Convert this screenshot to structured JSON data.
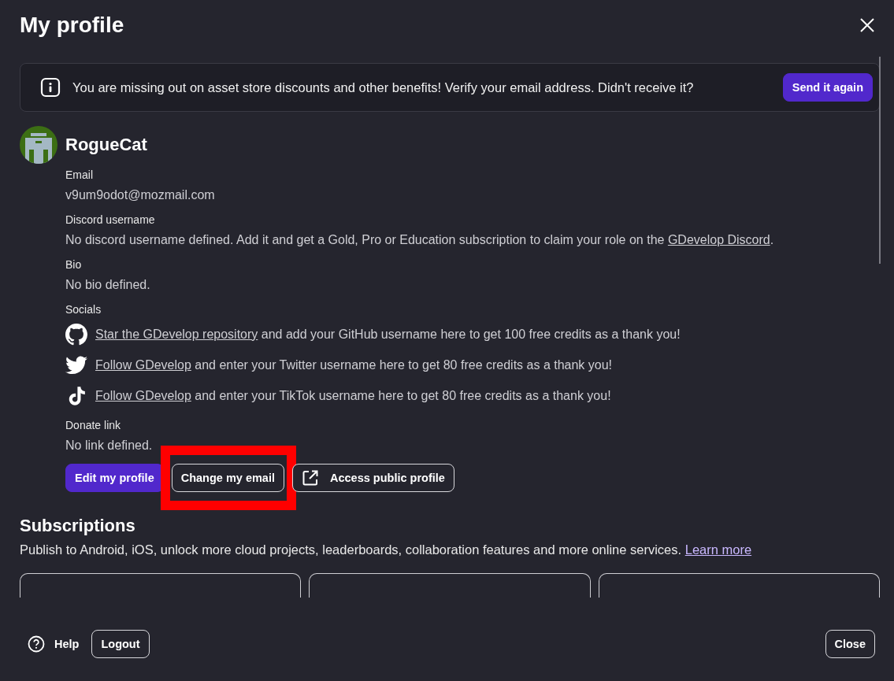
{
  "title": "My profile",
  "banner": {
    "message": "You are missing out on asset store discounts and other benefits! Verify your email address. Didn't receive it?",
    "button": "Send it again"
  },
  "user": {
    "name": "RogueCat"
  },
  "fields": [
    {
      "label": "Email",
      "value": "v9um9odot@mozmail.com"
    },
    {
      "label": "Discord username",
      "value": "No discord username defined. Add it and get a Gold, Pro or Education subscription to claim your role on the ",
      "link": "GDevelop Discord",
      "after": "."
    },
    {
      "label": "Bio",
      "value": "No bio defined."
    }
  ],
  "socials_label": "Socials",
  "socials": [
    {
      "kind": "github",
      "link": "Star the GDevelop repository",
      "text": " and add your GitHub username here to get 100 free credits as a thank you!"
    },
    {
      "kind": "twitter",
      "link": "Follow GDevelop",
      "text": " and enter your Twitter username here to get 80 free credits as a thank you!"
    },
    {
      "kind": "tiktok",
      "link": "Follow GDevelop",
      "text": " and enter your TikTok username here to get 80 free credits as a thank you!"
    }
  ],
  "donate": {
    "label": "Donate link",
    "value": "No link defined."
  },
  "actions": [
    {
      "label": "Edit my profile",
      "kind": "primary",
      "highlighted": false
    },
    {
      "label": "Change my email",
      "kind": "outline",
      "highlighted": true
    },
    {
      "label": "Access public profile",
      "kind": "external",
      "highlighted": false
    }
  ],
  "subscriptions": {
    "title": "Subscriptions",
    "text": "Publish to Android, iOS, unlock more cloud projects, leaderboards, collaboration features and more online services. ",
    "link": "Learn more",
    "cards": [
      {
        "kind": "plan"
      },
      {
        "kind": "plan"
      },
      {
        "kind": "plan"
      }
    ]
  },
  "footer": {
    "help": "Help",
    "logout": "Logout",
    "close": "Close"
  }
}
